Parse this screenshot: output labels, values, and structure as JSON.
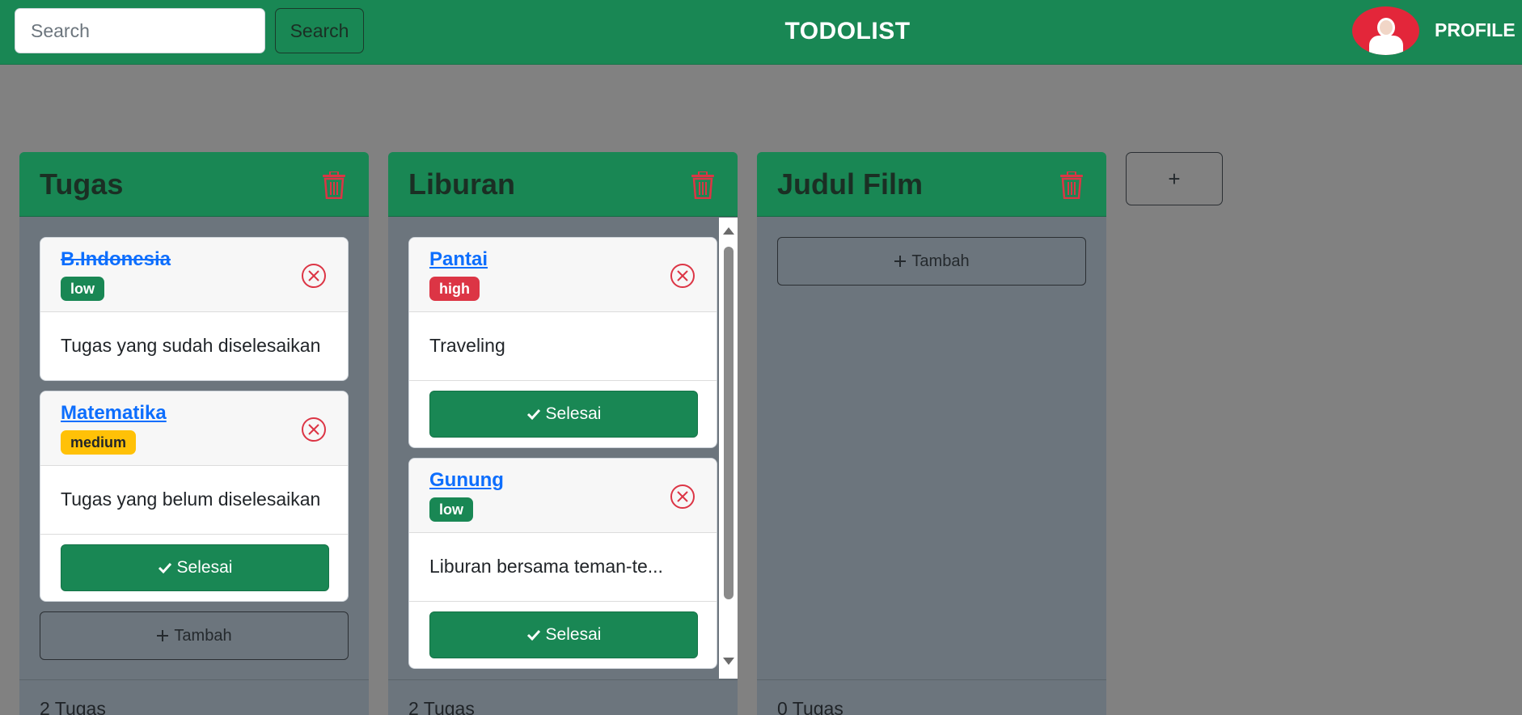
{
  "navbar": {
    "search_placeholder": "Search",
    "search_button": "Search",
    "brand": "TODOLIST",
    "profile_label": "PROFILE"
  },
  "columns": [
    {
      "title": "Tugas",
      "count_label": "2 Tugas",
      "add_label": "Tambah",
      "cards": [
        {
          "title": "B.Indonesia",
          "done": true,
          "priority": "low",
          "description": "Tugas yang sudah diselesaikan"
        },
        {
          "title": "Matematika",
          "done": false,
          "priority": "medium",
          "description": "Tugas yang belum diselesaikan",
          "done_button": "Selesai"
        }
      ]
    },
    {
      "title": "Liburan",
      "count_label": "2 Tugas",
      "cards": [
        {
          "title": "Pantai",
          "done": false,
          "priority": "high",
          "description": "Traveling",
          "done_button": "Selesai"
        },
        {
          "title": "Gunung",
          "done": false,
          "priority": "low",
          "description": "Liburan bersama teman-te...",
          "done_button": "Selesai"
        }
      ]
    },
    {
      "title": "Judul Film",
      "count_label": "0 Tugas",
      "add_label": "Tambah",
      "cards": []
    }
  ],
  "add_column_label": "+",
  "colors": {
    "primary_green": "#198754",
    "danger_red": "#dc3545",
    "warning_yellow": "#ffc107",
    "link_blue": "#0d6efd",
    "column_bg": "#6c757d",
    "page_bg": "#818181"
  },
  "icons": {
    "trash": "trash-icon",
    "close": "close-circle-icon",
    "check": "check-icon",
    "plus": "plus-icon"
  }
}
